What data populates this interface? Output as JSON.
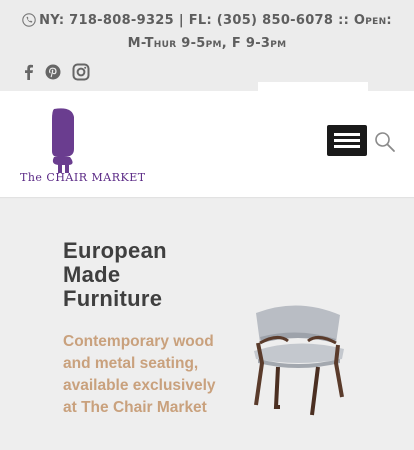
{
  "topbar": {
    "contact_line1": "NY: 718-808-9325 | FL: (305) 850-6078 :: Open:",
    "contact_line2": "M-Thur 9-5pm, F 9-3pm",
    "social_icons": [
      "facebook-icon",
      "pinterest-icon",
      "instagram-icon"
    ]
  },
  "header": {
    "logo_text": "The CHAIR MARKET",
    "logo_color": "#6a3d8f",
    "menu_icon": "hamburger-icon",
    "search_icon": "search-icon"
  },
  "hero": {
    "title": "European Made Furniture",
    "description": "Contemporary wood and metal seating, available exclusively at The Chair Market",
    "title_color": "#3f3f3f",
    "description_color": "#c9a17d"
  }
}
